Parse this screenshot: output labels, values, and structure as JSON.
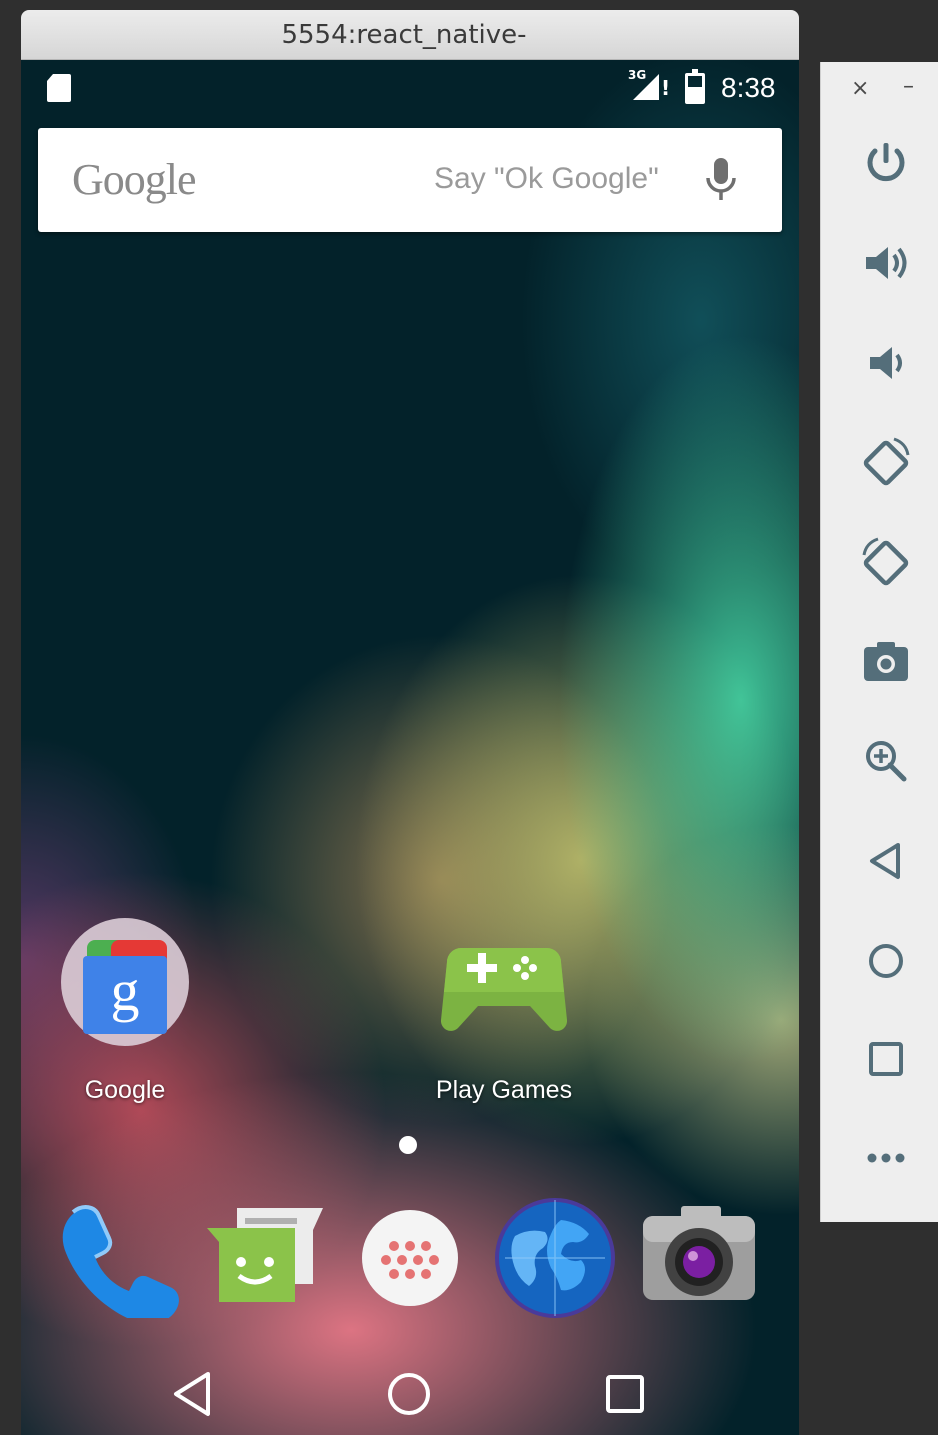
{
  "window": {
    "title": "5554:react_native-"
  },
  "statusbar": {
    "network_label": "3G",
    "time": "8:38"
  },
  "search": {
    "logo": "Google",
    "hint": "Say \"Ok Google\""
  },
  "home": {
    "apps": [
      {
        "label": "Google"
      },
      {
        "label": "Play Games"
      }
    ],
    "page_indicator": {
      "pages": 1,
      "current": 1
    }
  },
  "dock": [
    "phone-icon",
    "messaging-icon",
    "app-drawer-icon",
    "browser-globe-icon",
    "camera-icon"
  ],
  "navbar": [
    "back-icon",
    "home-icon",
    "recents-icon"
  ],
  "sidepanel": {
    "top_controls": {
      "close": "×",
      "minimize": "–"
    },
    "tools": [
      "power-icon",
      "volume-up-icon",
      "volume-down-icon",
      "rotate-left-icon",
      "rotate-right-icon",
      "camera-icon",
      "zoom-icon",
      "back-icon",
      "home-icon",
      "overview-icon",
      "more-icon"
    ]
  },
  "colors": {
    "panel_icon": "#546e7a",
    "google_blue": "#3f82e8",
    "games_green": "#8bc34a",
    "phone_blue": "#1e88e5",
    "messaging_green": "#8bc34a"
  }
}
